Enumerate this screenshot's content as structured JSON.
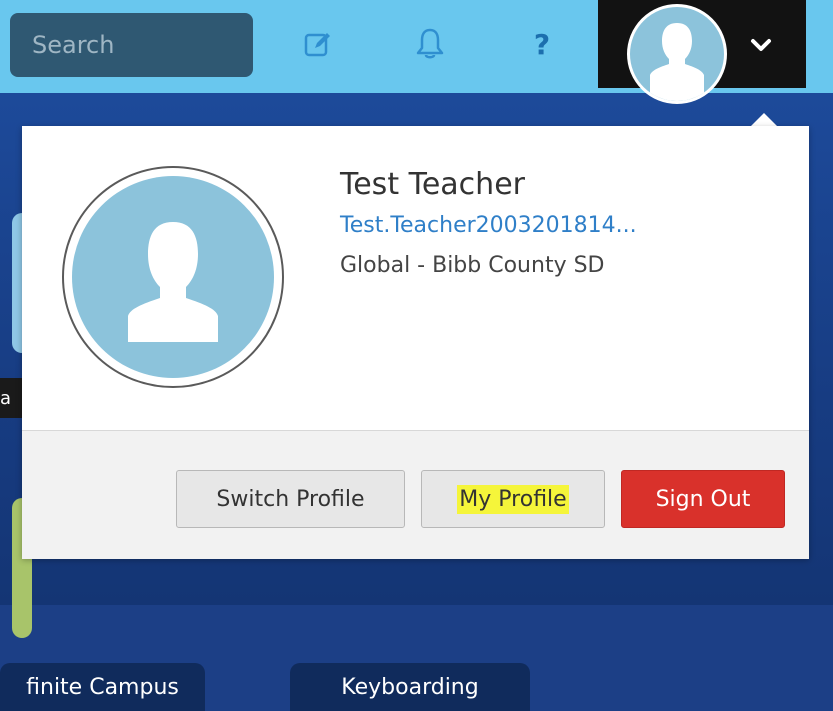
{
  "topbar": {
    "search_placeholder": "Search",
    "icons": [
      "edit-icon",
      "bell-icon",
      "help-icon",
      "chevron-down-icon"
    ],
    "help_glyph": "?"
  },
  "background": {
    "strip_text": "a",
    "pills": [
      "finite Campus",
      "Keyboarding"
    ]
  },
  "profile": {
    "name": "Test Teacher",
    "email": "Test.Teacher2003201814...",
    "org": "Global - Bibb County SD"
  },
  "buttons": {
    "switch_profile": "Switch Profile",
    "my_profile": "My Profile",
    "sign_out": "Sign Out"
  },
  "colors": {
    "topbar": "#69c7ee",
    "user_menu": "#121212",
    "sign_out": "#d9312b",
    "highlight": "#f5f53a",
    "link": "#2f7fc8"
  }
}
